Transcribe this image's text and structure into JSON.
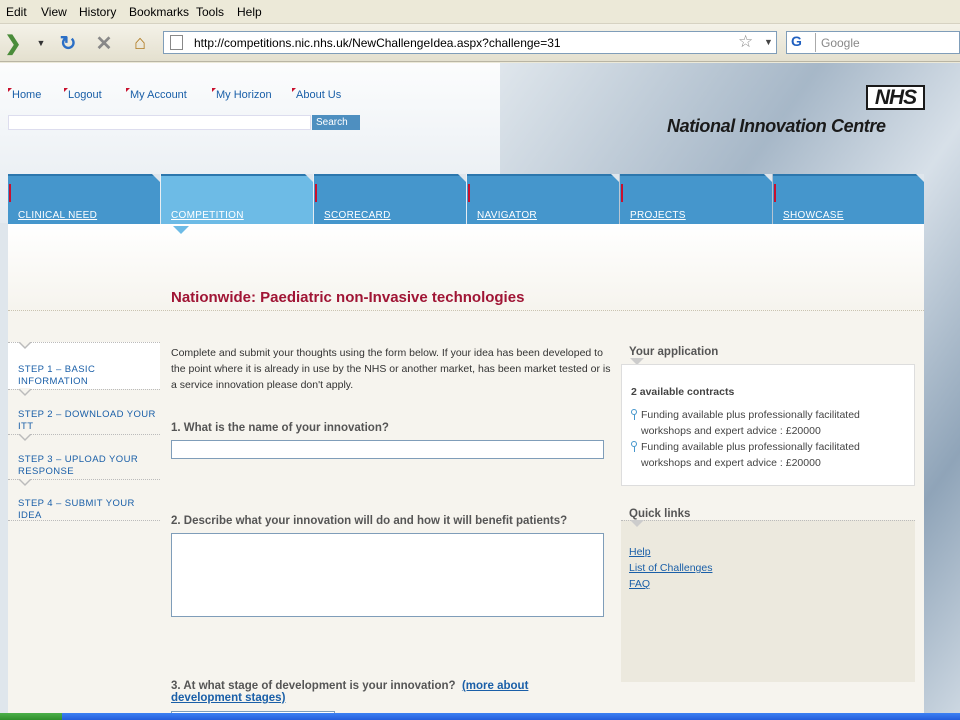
{
  "browser": {
    "menu": [
      "Edit",
      "View",
      "History",
      "Bookmarks",
      "Tools",
      "Help"
    ],
    "url": "http://competitions.nic.nhs.uk/NewChallengeIdea.aspx?challenge=31",
    "search_placeholder": "Google",
    "search_engine_icon": "G"
  },
  "site": {
    "top_links": [
      "Home",
      "Logout",
      "My Account",
      "My Horizon",
      "About Us"
    ],
    "search_button": "Search",
    "logo_text": "NHS",
    "org_name": "National Innovation Centre",
    "tabs": [
      {
        "label": "CLINICAL NEED",
        "active": false
      },
      {
        "label": "COMPETITION",
        "active": true
      },
      {
        "label": "SCORECARD",
        "active": false
      },
      {
        "label": "NAVIGATOR",
        "active": false
      },
      {
        "label": "PROJECTS",
        "active": false
      },
      {
        "label": "SHOWCASE",
        "active": false
      }
    ]
  },
  "page": {
    "title": "Nationwide: Paediatric non-Invasive technologies",
    "steps": [
      "STEP 1 – BASIC INFORMATION",
      "STEP 2 – DOWNLOAD YOUR ITT",
      "STEP 3 – UPLOAD YOUR RESPONSE",
      "STEP 4 – SUBMIT YOUR IDEA"
    ],
    "intro": "Complete and submit your thoughts using the form below. If your idea has been developed to the point where it is already in use by the NHS or another market, has been market tested or is a service innovation please don't apply.",
    "q1": "1. What is the name of your innovation?",
    "q2": "2. Describe what your innovation will do and how it will benefit patients?",
    "q3": "3. At what stage of development is your innovation?",
    "q3_link": "(more about development stages)"
  },
  "sidebar": {
    "application_heading": "Your application",
    "contracts_heading": "2 available contracts",
    "contracts": [
      "Funding available plus professionally facilitated workshops and expert advice : £20000",
      "Funding available plus professionally facilitated workshops and expert advice : £20000"
    ],
    "quick_links_heading": "Quick links",
    "quick_links": [
      "Help",
      "List of Challenges",
      "FAQ"
    ]
  },
  "colors": {
    "tab_blue": "#4596cc",
    "tab_active": "#6dbbe6",
    "heading_red": "#a01535",
    "link_blue": "#1a5fa8"
  }
}
